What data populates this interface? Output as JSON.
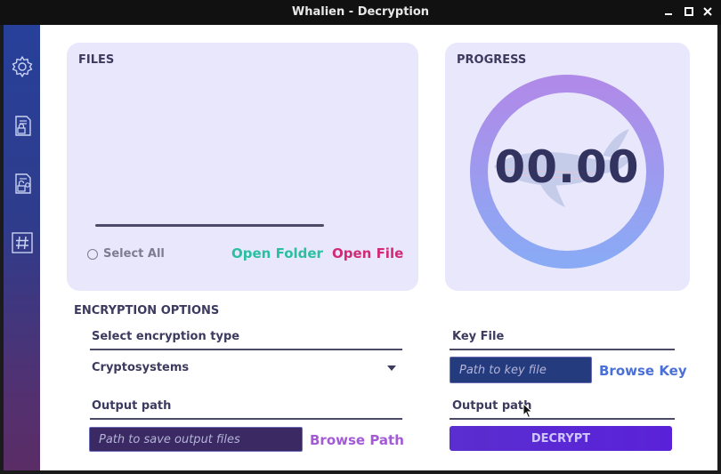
{
  "window": {
    "title": "Whalien - Decryption",
    "controls": {
      "minimize": "_",
      "maximize": "□",
      "close": "✕"
    }
  },
  "sidebar": {
    "items": [
      {
        "icon": "gear-icon"
      },
      {
        "icon": "lock-document-icon"
      },
      {
        "icon": "unlock-document-icon"
      },
      {
        "icon": "hash-icon"
      }
    ]
  },
  "files": {
    "title": "FILES",
    "select_all_label": "Select All",
    "open_folder_label": "Open Folder",
    "open_file_label": "Open File"
  },
  "progress": {
    "title": "PROGRESS",
    "value": "00.00"
  },
  "encryption": {
    "section_title": "ENCRYPTION OPTIONS",
    "type_label": "Select encryption type",
    "type_value": "Cryptosystems",
    "output_label": "Output path",
    "output_placeholder": "Path to save output files",
    "browse_path_label": "Browse Path",
    "key_label": "Key File",
    "key_placeholder": "Path to key file",
    "browse_key_label": "Browse Key",
    "output_label_right": "Output path",
    "decrypt_label": "DECRYPT"
  },
  "colors": {
    "panel_bg": "#e9e7fc",
    "open_folder": "#2bbf9f",
    "open_file": "#d12a76",
    "browse_key": "#4a6fd6",
    "browse_path": "#a35ad6",
    "decrypt_bg": "#5a22d8",
    "ring_top": "#b08ae8",
    "ring_bottom": "#8aaaf5"
  }
}
